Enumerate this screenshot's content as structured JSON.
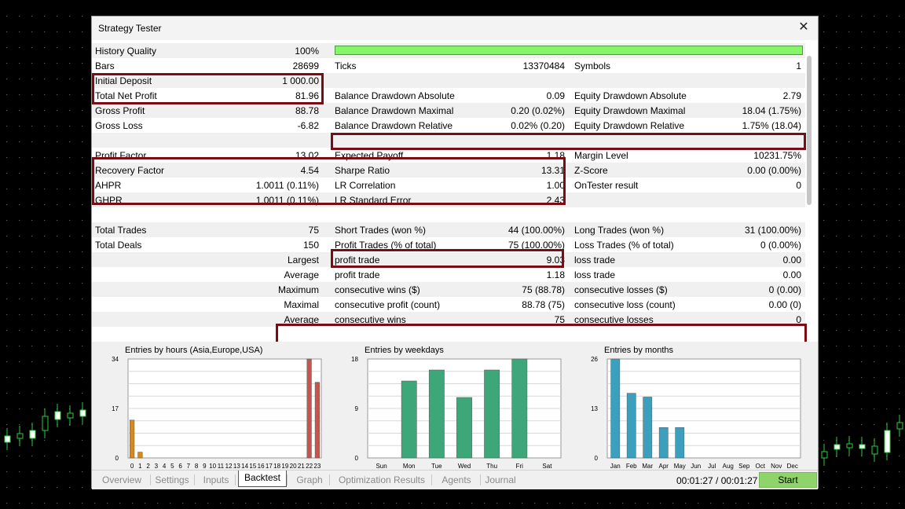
{
  "window": {
    "title": "Strategy Tester",
    "close_glyph": "✕"
  },
  "report": {
    "history_quality": {
      "label": "History Quality",
      "value": "100%",
      "progress": 1.0
    },
    "rows": [
      {
        "c1": [
          "Bars",
          "28699"
        ],
        "c2": [
          "Ticks",
          "13370484"
        ],
        "c3": [
          "Symbols",
          "1"
        ]
      },
      {
        "c1": [
          "Initial Deposit",
          "1 000.00"
        ],
        "c2": [
          "",
          ""
        ],
        "c3": [
          "",
          ""
        ]
      },
      {
        "c1": [
          "Total Net Profit",
          "81.96"
        ],
        "c2": [
          "Balance Drawdown Absolute",
          "0.09"
        ],
        "c3": [
          "Equity Drawdown Absolute",
          "2.79"
        ]
      },
      {
        "c1": [
          "Gross Profit",
          "88.78"
        ],
        "c2": [
          "Balance Drawdown Maximal",
          "0.20 (0.02%)"
        ],
        "c3": [
          "Equity Drawdown Maximal",
          "18.04 (1.75%)"
        ]
      },
      {
        "c1": [
          "Gross Loss",
          "-6.82"
        ],
        "c2": [
          "Balance Drawdown Relative",
          "0.02% (0.20)"
        ],
        "c3": [
          "Equity Drawdown Relative",
          "1.75% (18.04)"
        ]
      },
      {
        "c1": [
          "",
          ""
        ],
        "c2": [
          "",
          ""
        ],
        "c3": [
          "",
          ""
        ]
      },
      {
        "c1": [
          "Profit Factor",
          "13.02"
        ],
        "c2": [
          "Expected Payoff",
          "1.18"
        ],
        "c3": [
          "Margin Level",
          "10231.75%"
        ]
      },
      {
        "c1": [
          "Recovery Factor",
          "4.54"
        ],
        "c2": [
          "Sharpe Ratio",
          "13.31"
        ],
        "c3": [
          "Z-Score",
          "0.00 (0.00%)"
        ]
      },
      {
        "c1": [
          "AHPR",
          "1.0011 (0.11%)"
        ],
        "c2": [
          "LR Correlation",
          "1.00"
        ],
        "c3": [
          "OnTester result",
          "0"
        ]
      },
      {
        "c1": [
          "GHPR",
          "1.0011 (0.11%)"
        ],
        "c2": [
          "LR Standard Error",
          "2.43"
        ],
        "c3": [
          "",
          ""
        ]
      },
      {
        "c1": [
          "",
          ""
        ],
        "c2": [
          "",
          ""
        ],
        "c3": [
          "",
          ""
        ]
      },
      {
        "c1": [
          "Total Trades",
          "75"
        ],
        "c2": [
          "Short Trades (won %)",
          "44 (100.00%)"
        ],
        "c3": [
          "Long Trades (won %)",
          "31 (100.00%)"
        ]
      },
      {
        "c1": [
          "Total Deals",
          "150"
        ],
        "c2": [
          "Profit Trades (% of total)",
          "75 (100.00%)"
        ],
        "c3": [
          "Loss Trades (% of total)",
          "0 (0.00%)"
        ]
      },
      {
        "c1": [
          "",
          "Largest"
        ],
        "c2": [
          "profit trade",
          "9.03"
        ],
        "c3": [
          "loss trade",
          "0.00"
        ]
      },
      {
        "c1": [
          "",
          "Average"
        ],
        "c2": [
          "profit trade",
          "1.18"
        ],
        "c3": [
          "loss trade",
          "0.00"
        ]
      },
      {
        "c1": [
          "",
          "Maximum"
        ],
        "c2": [
          "consecutive wins ($)",
          "75 (88.78)"
        ],
        "c3": [
          "consecutive losses ($)",
          "0 (0.00)"
        ]
      },
      {
        "c1": [
          "",
          "Maximal"
        ],
        "c2": [
          "consecutive profit (count)",
          "88.78 (75)"
        ],
        "c3": [
          "consecutive loss (count)",
          "0.00 (0)"
        ]
      },
      {
        "c1": [
          "",
          "Average"
        ],
        "c2": [
          "consecutive wins",
          "75"
        ],
        "c3": [
          "consecutive losses",
          "0"
        ]
      },
      {
        "c1": [
          "",
          ""
        ],
        "c2": [
          "",
          ""
        ],
        "c3": [
          "",
          ""
        ]
      }
    ]
  },
  "colors": {
    "highlight": "#7a0c14",
    "progress": "#87f56a",
    "start": "#8fd46a"
  },
  "chart_data": [
    {
      "type": "bar",
      "title": "Entries by hours (Asia,Europe,USA)",
      "categories": [
        "0",
        "1",
        "2",
        "3",
        "4",
        "5",
        "6",
        "7",
        "8",
        "9",
        "10",
        "11",
        "12",
        "13",
        "14",
        "15",
        "16",
        "17",
        "18",
        "19",
        "20",
        "21",
        "22",
        "23"
      ],
      "values": [
        13,
        2,
        0,
        0,
        0,
        0,
        0,
        0,
        0,
        0,
        0,
        0,
        0,
        0,
        0,
        0,
        0,
        0,
        0,
        0,
        0,
        0,
        34,
        26
      ],
      "yticks": [
        "0",
        "17",
        "34"
      ],
      "ylim": [
        0,
        34
      ],
      "colors": [
        "#d5891f",
        "#d5891f",
        "#d5891f",
        "#d5891f",
        "#d5891f",
        "#d5891f",
        "#d5891f",
        "#d5891f",
        "#d5891f",
        "#d5891f",
        "#d5891f",
        "#d5891f",
        "#d5891f",
        "#d5891f",
        "#d5891f",
        "#d5891f",
        "#d5891f",
        "#d5891f",
        "#d5891f",
        "#d5891f",
        "#d5891f",
        "#d5891f",
        "#c9544a",
        "#c9544a"
      ]
    },
    {
      "type": "bar",
      "title": "Entries by weekdays",
      "categories": [
        "Sun",
        "Mon",
        "Tue",
        "Wed",
        "Thu",
        "Fri",
        "Sat"
      ],
      "values": [
        0,
        14,
        16,
        11,
        16,
        18,
        0
      ],
      "yticks": [
        "0",
        "9",
        "18"
      ],
      "ylim": [
        0,
        18
      ],
      "colors": [
        "#3ea77a",
        "#3ea77a",
        "#3ea77a",
        "#3ea77a",
        "#3ea77a",
        "#3ea77a",
        "#3ea77a"
      ]
    },
    {
      "type": "bar",
      "title": "Entries by months",
      "categories": [
        "Jan",
        "Feb",
        "Mar",
        "Apr",
        "May",
        "Jun",
        "Jul",
        "Aug",
        "Sep",
        "Oct",
        "Nov",
        "Dec"
      ],
      "values": [
        26,
        17,
        16,
        8,
        8,
        0,
        0,
        0,
        0,
        0,
        0,
        0
      ],
      "yticks": [
        "0",
        "13",
        "26"
      ],
      "ylim": [
        0,
        26
      ],
      "colors": [
        "#3aa0bd",
        "#3aa0bd",
        "#3aa0bd",
        "#3aa0bd",
        "#3aa0bd",
        "#3aa0bd",
        "#3aa0bd",
        "#3aa0bd",
        "#3aa0bd",
        "#3aa0bd",
        "#3aa0bd",
        "#3aa0bd"
      ]
    }
  ],
  "tabs": [
    "Overview",
    "Settings",
    "Inputs",
    "Backtest",
    "Graph",
    "Optimization Results",
    "Agents",
    "Journal"
  ],
  "active_tab": "Backtest",
  "timer": "00:01:27 / 00:01:27",
  "start_label": "Start"
}
